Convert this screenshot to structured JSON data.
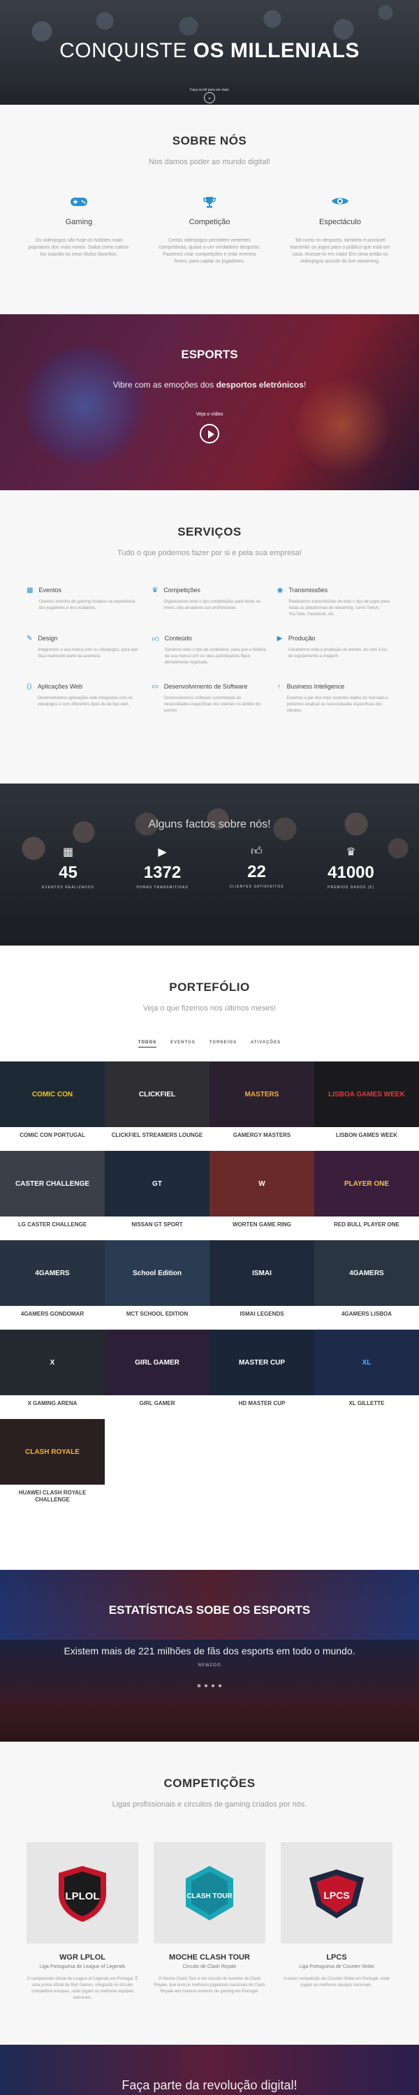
{
  "hero": {
    "title_light": "CONQUISTE ",
    "title_bold": "OS MILLENIALS",
    "tiny": "Faça scroll para ver mais"
  },
  "sobre": {
    "title": "SOBRE NÓS",
    "subtitle": "Nos damos poder ao mundo digital!",
    "cols": [
      {
        "icon": "gamepad-icon",
        "title": "Gaming",
        "text": "Os videojogos são hoje os hobbies mais populares dos mais novos. Saiba como cativa-los usando os seus títulos favoritos."
      },
      {
        "icon": "trophy-icon",
        "title": "Competição",
        "text": "Certos videojogos permitem vertentes competitivas, quase a um verdadeiro desporto. Fazemos criar competições e criar eventos fortes, para captar os jogadores."
      },
      {
        "icon": "eye-icon",
        "title": "Espectáculo",
        "text": "Tal como no desporto, também é possível transmitir os jogos para o público que está em casa. Acesse-lo em mais! Em cima então os videojogos assistir do live streaming."
      }
    ]
  },
  "esports": {
    "title": "ESPORTS",
    "sub_a": "Vibre com as emoções dos ",
    "sub_b": "desportos eletrónicos",
    "sub_c": "!",
    "watch": "Veja o vídeo"
  },
  "servicos": {
    "title": "SERVIÇOS",
    "subtitle": "Tudo o que podemos fazer por si e pela sua empresa!",
    "items": [
      {
        "icon": "calendar-icon",
        "title": "Eventos",
        "text": "Criamos eventos de gaming focados na experiência dos jogadores e dos visitantes."
      },
      {
        "icon": "trophy-icon",
        "title": "Competições",
        "text": "Organizamos todo o tipo competições para todos os níveis, dos amadores aos profissionais."
      },
      {
        "icon": "broadcast-icon",
        "title": "Transmissões",
        "text": "Realizamos transmissões de todo o tipo de jogos para todas as plataformas de streaming, como Twitch, YouTube, Facebook, etc."
      },
      {
        "icon": "pencil-icon",
        "title": "Design",
        "text": "Integramos a sua marca com os videojogos, para que faça realmente parte da aventura."
      },
      {
        "icon": "thumbs-up-icon",
        "title": "Conteúdo",
        "text": "Geramos todo o tipo de conteúdos, para que a história da sua marca com os seus participantes fique devidamente registada."
      },
      {
        "icon": "video-camera-icon",
        "title": "Produção",
        "text": "Garantimos toda a produção do evento, do som à luz, do equipamento à imagem."
      },
      {
        "icon": "code-icon",
        "title": "Aplicações Web",
        "text": "Desenvolvemos aplicações web integradas com os videojogos e com diferentes tipos de de tipo web."
      },
      {
        "icon": "laptop-icon",
        "title": "Desenvolvimento de Software",
        "text": "Desenvolvemos software customizado às necessidades específicas dos clientes no âmbito do evento."
      },
      {
        "icon": "rocket-icon",
        "title": "Business Inteligence",
        "text": "Estamos a par dos mais recentes dados do mercado e podemos analisar as necessidades específicas dos clientes."
      }
    ]
  },
  "factos": {
    "title": "Alguns factos sobre nós!",
    "stats": [
      {
        "icon": "calendar-icon",
        "num": "45",
        "label": "EVENTOS REALIZADOS"
      },
      {
        "icon": "play-icon",
        "num": "1372",
        "label": "HORAS TRANSMITIDAS"
      },
      {
        "icon": "thumbs-up-icon",
        "num": "22",
        "label": "CLIENTES SATISFEITOS"
      },
      {
        "icon": "trophy-icon",
        "num": "41000",
        "label": "PRÉMIOS DADOS (€)"
      }
    ]
  },
  "portfolio": {
    "title": "PORTEFÓLIO",
    "subtitle": "Veja o que fizemos nos últimos meses!",
    "filters": [
      "TODOS",
      "EVENTOS",
      "TORNEIOS",
      "ATIVAÇÕES"
    ],
    "items": [
      {
        "caption": "COMIC CON PORTUGAL",
        "logo": "COMIC CON",
        "bg": "#1d2a35",
        "fg": "#f4c21f"
      },
      {
        "caption": "CLICKFIEL STREAMERS LOUNGE",
        "logo": "CLICKFIEL",
        "bg": "#2e2e33",
        "fg": "#ffffff"
      },
      {
        "caption": "GAMERGY MASTERS",
        "logo": "MASTERS",
        "bg": "#2b2030",
        "fg": "#f2b134"
      },
      {
        "caption": "LISBON GAMES WEEK",
        "logo": "LISBOA GAMES WEEK",
        "bg": "#1a1a1e",
        "fg": "#e03a3a"
      },
      {
        "caption": "LG CASTER CHALLENGE",
        "logo": "CASTER CHALLENGE",
        "bg": "#3a3f4a",
        "fg": "#ffffff"
      },
      {
        "caption": "NISSAN GT SPORT",
        "logo": "GT",
        "bg": "#1f2a3a",
        "fg": "#ffffff"
      },
      {
        "caption": "WORTEN GAME RING",
        "logo": "W",
        "bg": "#6a2a2a",
        "fg": "#ffffff"
      },
      {
        "caption": "RED BULL PLAYER ONE",
        "logo": "PLAYER ONE",
        "bg": "#3a1e3c",
        "fg": "#f3c143"
      },
      {
        "caption": "4GAMERS GONDOMAR",
        "logo": "4GAMERS",
        "bg": "#273342",
        "fg": "#ffffff"
      },
      {
        "caption": "MCT SCHOOL EDITION",
        "logo": "School Edition",
        "bg": "#2a3c52",
        "fg": "#ffffff"
      },
      {
        "caption": "ISMAI LEGENDS",
        "logo": "ISMAI",
        "bg": "#1e2a3a",
        "fg": "#ffffff"
      },
      {
        "caption": "4GAMERS LISBOA",
        "logo": "4GAMERS",
        "bg": "#2a3542",
        "fg": "#ffffff"
      },
      {
        "caption": "X GAMING ARENA",
        "logo": "X",
        "bg": "#242a30",
        "fg": "#ffffff"
      },
      {
        "caption": "GIRL GAMER",
        "logo": "GIRL GAMER",
        "bg": "#2c2038",
        "fg": "#ffffff"
      },
      {
        "caption": "HD MASTER CUP",
        "logo": "MASTER CUP",
        "bg": "#1a2638",
        "fg": "#ffffff"
      },
      {
        "caption": "XL GILLETTE",
        "logo": "XL",
        "bg": "#1e2a4a",
        "fg": "#4fb4ff"
      },
      {
        "caption": "HUAWEI CLASH ROYALE CHALLENGE",
        "logo": "CLASH ROYALE",
        "bg": "#2a2020",
        "fg": "#f2b134"
      }
    ]
  },
  "estat": {
    "title": "ESTATÍSTICAS SOBE OS ESPORTS",
    "quote": "Existem mais de 221 milhões de fãs dos esports em todo o mundo.",
    "src": "NEWZOO"
  },
  "comp": {
    "title": "COMPETIÇÕES",
    "subtitle": "Ligas profissionais e circuitos de gaming criados por nós.",
    "cards": [
      {
        "logo": "LPLOL",
        "bg": "#e7e7e7",
        "badge": "#c3152a",
        "title": "WGR LPLOL",
        "small": "Liga Portuguesa de League of Legends",
        "text": "O campeonato oficial de League of Legends em Portugal. É uma prova oficial da Riot Games, integrada no circuito competitivo europeu, onde jogam as melhores equipas nacionais."
      },
      {
        "logo": "CLASH TOUR",
        "bg": "#e7e7e7",
        "badge": "#1aa6b6",
        "title": "MOCHE CLASH TOUR",
        "small": "Circuito de Clash Royale",
        "text": "O Moche Clash Tour é um circuito de eventos de Clash Royale, que leva os melhores jogadores nacionais de Clash Royale aos maiores eventos de gaming em Portugal."
      },
      {
        "logo": "LPCS",
        "bg": "#e7e7e7",
        "badge": "#1d2740",
        "title": "LPCS",
        "small": "Liga Portuguesa de Counter-Strike",
        "text": "A maior competição de Counter-Strike em Portugal, onde jogam as melhores equipas nacionais."
      }
    ]
  },
  "cta": {
    "title": "Faça parte da revolução digital!"
  }
}
